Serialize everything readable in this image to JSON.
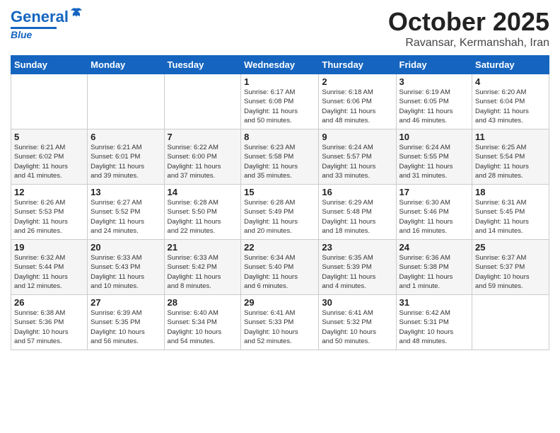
{
  "header": {
    "logo_general": "General",
    "logo_blue": "Blue",
    "month_title": "October 2025",
    "location": "Ravansar, Kermanshah, Iran"
  },
  "weekdays": [
    "Sunday",
    "Monday",
    "Tuesday",
    "Wednesday",
    "Thursday",
    "Friday",
    "Saturday"
  ],
  "weeks": [
    [
      {
        "day": "",
        "info": ""
      },
      {
        "day": "",
        "info": ""
      },
      {
        "day": "",
        "info": ""
      },
      {
        "day": "1",
        "info": "Sunrise: 6:17 AM\nSunset: 6:08 PM\nDaylight: 11 hours\nand 50 minutes."
      },
      {
        "day": "2",
        "info": "Sunrise: 6:18 AM\nSunset: 6:06 PM\nDaylight: 11 hours\nand 48 minutes."
      },
      {
        "day": "3",
        "info": "Sunrise: 6:19 AM\nSunset: 6:05 PM\nDaylight: 11 hours\nand 46 minutes."
      },
      {
        "day": "4",
        "info": "Sunrise: 6:20 AM\nSunset: 6:04 PM\nDaylight: 11 hours\nand 43 minutes."
      }
    ],
    [
      {
        "day": "5",
        "info": "Sunrise: 6:21 AM\nSunset: 6:02 PM\nDaylight: 11 hours\nand 41 minutes."
      },
      {
        "day": "6",
        "info": "Sunrise: 6:21 AM\nSunset: 6:01 PM\nDaylight: 11 hours\nand 39 minutes."
      },
      {
        "day": "7",
        "info": "Sunrise: 6:22 AM\nSunset: 6:00 PM\nDaylight: 11 hours\nand 37 minutes."
      },
      {
        "day": "8",
        "info": "Sunrise: 6:23 AM\nSunset: 5:58 PM\nDaylight: 11 hours\nand 35 minutes."
      },
      {
        "day": "9",
        "info": "Sunrise: 6:24 AM\nSunset: 5:57 PM\nDaylight: 11 hours\nand 33 minutes."
      },
      {
        "day": "10",
        "info": "Sunrise: 6:24 AM\nSunset: 5:55 PM\nDaylight: 11 hours\nand 31 minutes."
      },
      {
        "day": "11",
        "info": "Sunrise: 6:25 AM\nSunset: 5:54 PM\nDaylight: 11 hours\nand 28 minutes."
      }
    ],
    [
      {
        "day": "12",
        "info": "Sunrise: 6:26 AM\nSunset: 5:53 PM\nDaylight: 11 hours\nand 26 minutes."
      },
      {
        "day": "13",
        "info": "Sunrise: 6:27 AM\nSunset: 5:52 PM\nDaylight: 11 hours\nand 24 minutes."
      },
      {
        "day": "14",
        "info": "Sunrise: 6:28 AM\nSunset: 5:50 PM\nDaylight: 11 hours\nand 22 minutes."
      },
      {
        "day": "15",
        "info": "Sunrise: 6:28 AM\nSunset: 5:49 PM\nDaylight: 11 hours\nand 20 minutes."
      },
      {
        "day": "16",
        "info": "Sunrise: 6:29 AM\nSunset: 5:48 PM\nDaylight: 11 hours\nand 18 minutes."
      },
      {
        "day": "17",
        "info": "Sunrise: 6:30 AM\nSunset: 5:46 PM\nDaylight: 11 hours\nand 16 minutes."
      },
      {
        "day": "18",
        "info": "Sunrise: 6:31 AM\nSunset: 5:45 PM\nDaylight: 11 hours\nand 14 minutes."
      }
    ],
    [
      {
        "day": "19",
        "info": "Sunrise: 6:32 AM\nSunset: 5:44 PM\nDaylight: 11 hours\nand 12 minutes."
      },
      {
        "day": "20",
        "info": "Sunrise: 6:33 AM\nSunset: 5:43 PM\nDaylight: 11 hours\nand 10 minutes."
      },
      {
        "day": "21",
        "info": "Sunrise: 6:33 AM\nSunset: 5:42 PM\nDaylight: 11 hours\nand 8 minutes."
      },
      {
        "day": "22",
        "info": "Sunrise: 6:34 AM\nSunset: 5:40 PM\nDaylight: 11 hours\nand 6 minutes."
      },
      {
        "day": "23",
        "info": "Sunrise: 6:35 AM\nSunset: 5:39 PM\nDaylight: 11 hours\nand 4 minutes."
      },
      {
        "day": "24",
        "info": "Sunrise: 6:36 AM\nSunset: 5:38 PM\nDaylight: 11 hours\nand 1 minute."
      },
      {
        "day": "25",
        "info": "Sunrise: 6:37 AM\nSunset: 5:37 PM\nDaylight: 10 hours\nand 59 minutes."
      }
    ],
    [
      {
        "day": "26",
        "info": "Sunrise: 6:38 AM\nSunset: 5:36 PM\nDaylight: 10 hours\nand 57 minutes."
      },
      {
        "day": "27",
        "info": "Sunrise: 6:39 AM\nSunset: 5:35 PM\nDaylight: 10 hours\nand 56 minutes."
      },
      {
        "day": "28",
        "info": "Sunrise: 6:40 AM\nSunset: 5:34 PM\nDaylight: 10 hours\nand 54 minutes."
      },
      {
        "day": "29",
        "info": "Sunrise: 6:41 AM\nSunset: 5:33 PM\nDaylight: 10 hours\nand 52 minutes."
      },
      {
        "day": "30",
        "info": "Sunrise: 6:41 AM\nSunset: 5:32 PM\nDaylight: 10 hours\nand 50 minutes."
      },
      {
        "day": "31",
        "info": "Sunrise: 6:42 AM\nSunset: 5:31 PM\nDaylight: 10 hours\nand 48 minutes."
      },
      {
        "day": "",
        "info": ""
      }
    ]
  ]
}
